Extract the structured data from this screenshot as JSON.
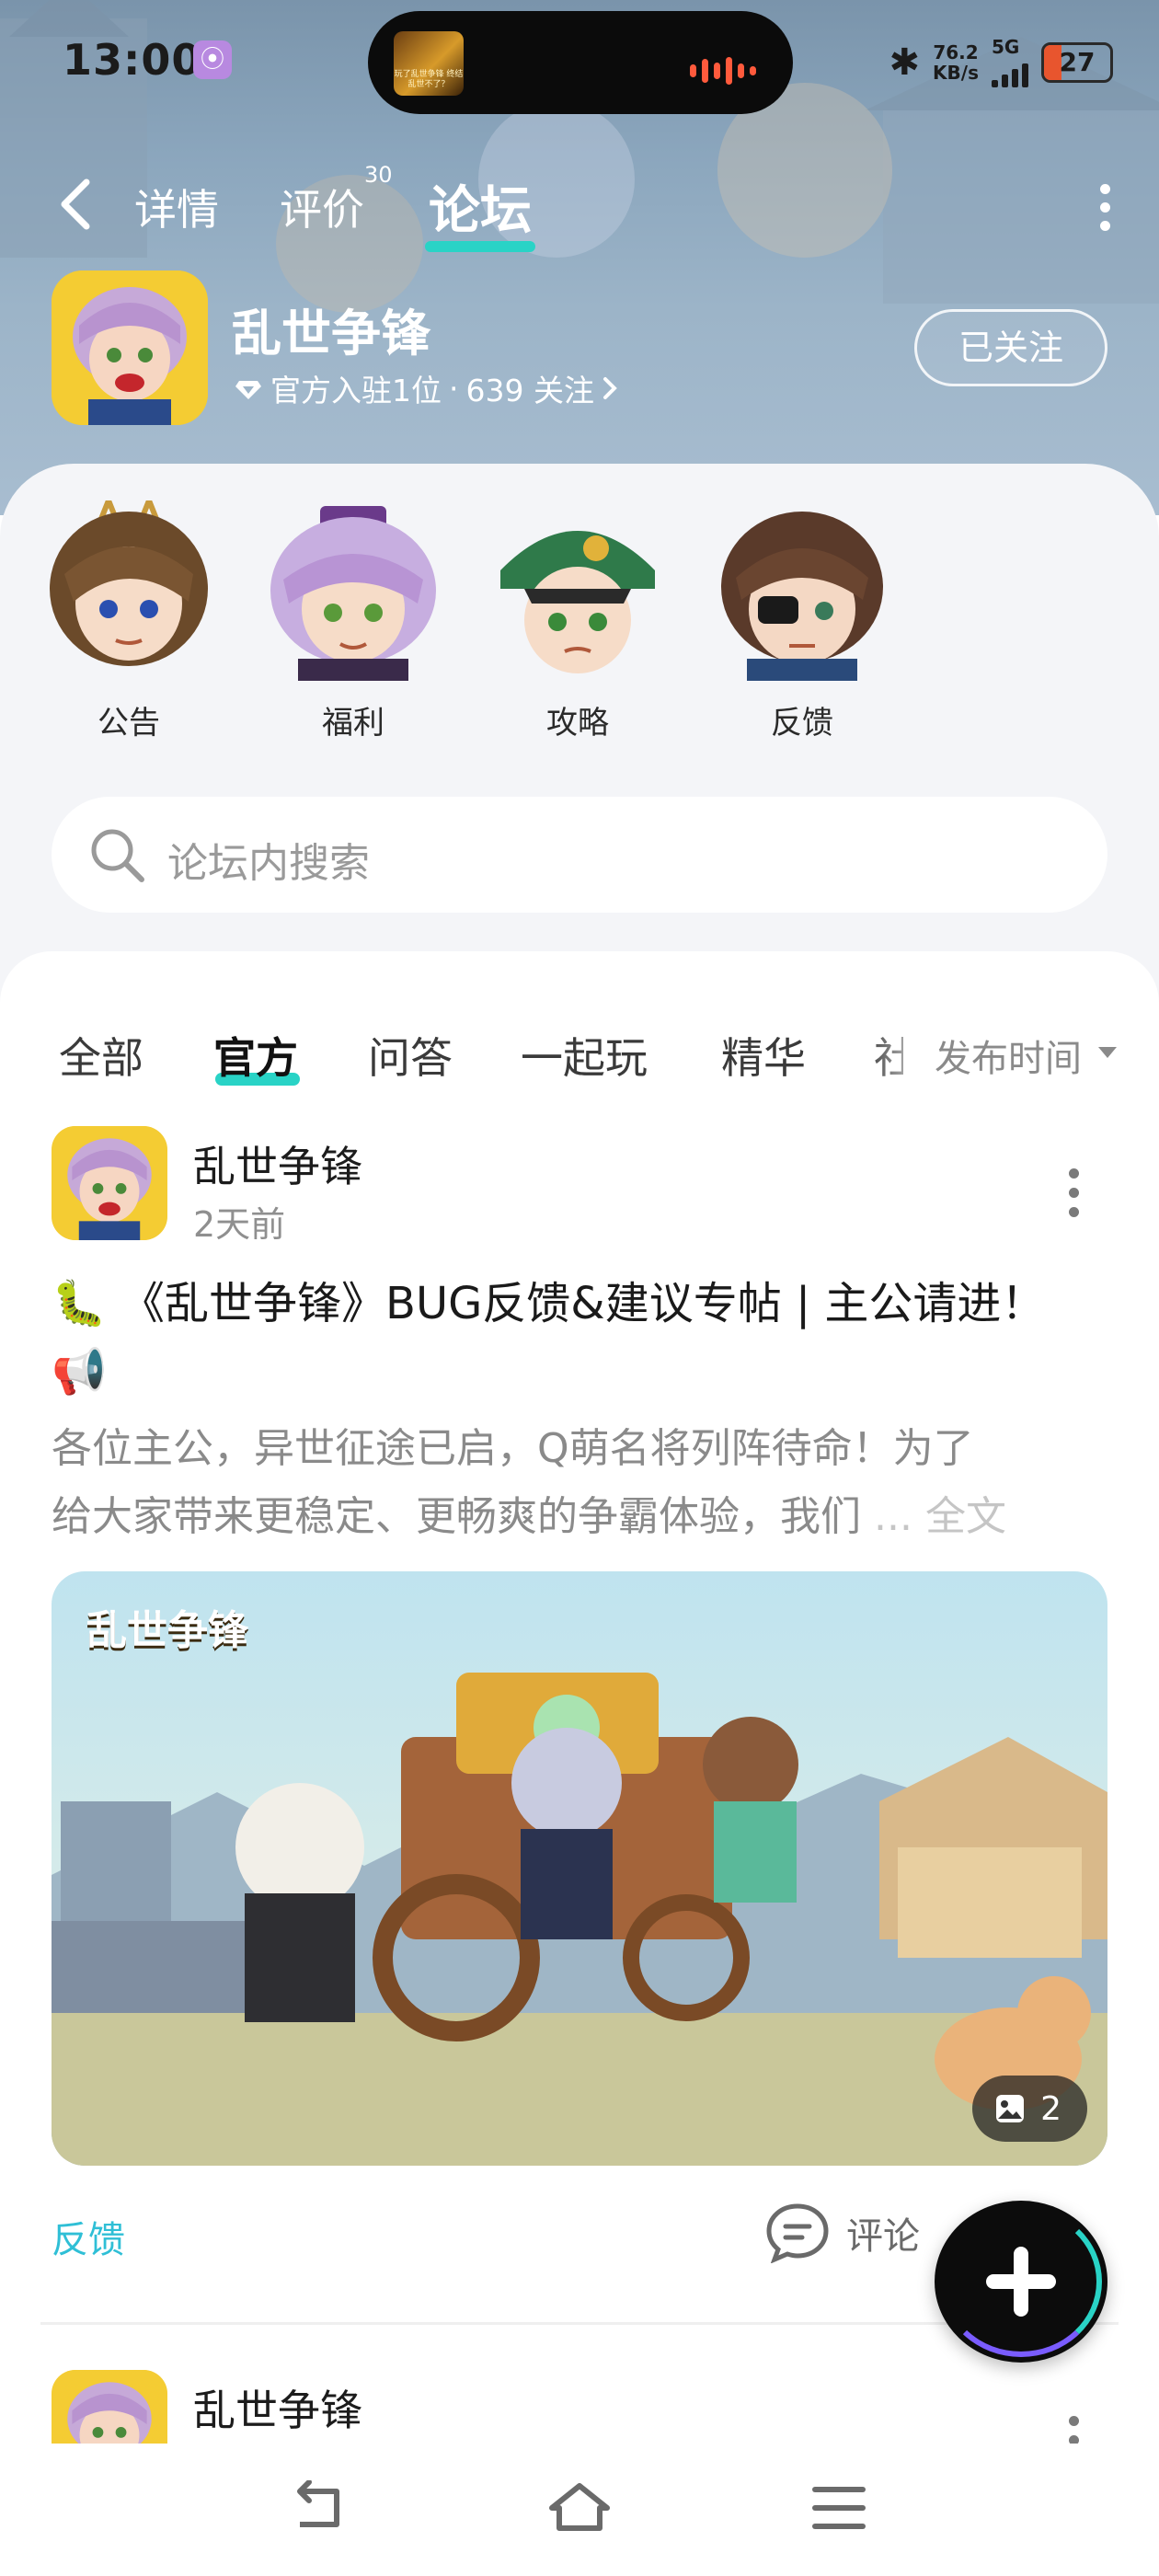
{
  "status_bar": {
    "time": "13:00",
    "app_badge_icon": "app-indicator-icon",
    "island_thumb_text": "玩了乱世争锋 终结乱世不了？",
    "net_speed_value": "76.2",
    "net_speed_unit": "KB/s",
    "network_type": "5G",
    "battery_level": "27",
    "battery_fill_fraction": 0.27
  },
  "nav": {
    "tabs": [
      "详情",
      "评价",
      "论坛"
    ],
    "review_count": "30",
    "active_tab": "论坛",
    "accent_color": "#29d3c6"
  },
  "game": {
    "name": "乱世争锋",
    "official_text": "官方入驻1位",
    "separator": "·",
    "follower_text": "639 关注",
    "follow_button": "已关注"
  },
  "channels": [
    {
      "label": "公告"
    },
    {
      "label": "福利"
    },
    {
      "label": "攻略"
    },
    {
      "label": "反馈"
    }
  ],
  "search": {
    "placeholder": "论坛内搜索"
  },
  "feed_tabs": {
    "items": [
      "全部",
      "官方",
      "问答",
      "一起玩",
      "精华",
      "社"
    ],
    "active": "官方",
    "sort_label": "发布时间"
  },
  "posts": [
    {
      "author": "乱世争锋",
      "time": "2天前",
      "title_prefix_icon": "🐛",
      "title": "《乱世争锋》BUG反馈&建议专帖 | 主公请进！",
      "title_suffix_icon": "📢",
      "excerpt_line1": "各位主公，异世征途已启，Q萌名将列阵待命！为了",
      "excerpt_line2": "给大家带来更稳定、更畅爽的争霸体验，我们",
      "ellipsis": "...",
      "fulltext_label": "全文",
      "image_logo": "乱世争锋",
      "image_count": "2",
      "tag": "反馈",
      "comment_label": "评论"
    },
    {
      "author": "乱世争锋"
    }
  ]
}
